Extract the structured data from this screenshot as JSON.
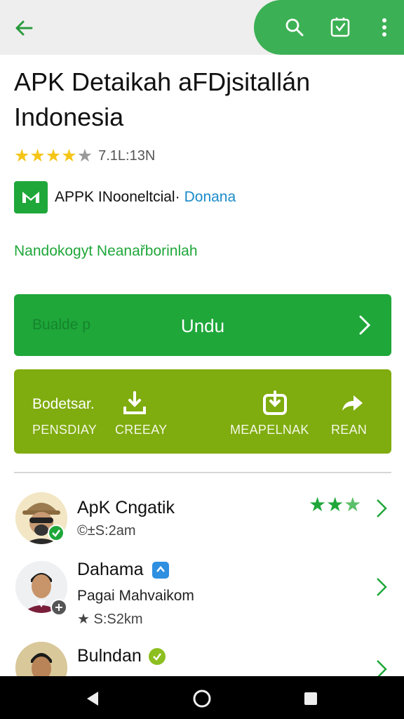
{
  "app_bar": {
    "back_icon": "arrow-left-icon",
    "search_icon": "search-icon",
    "badge_icon": "shield-badge-icon",
    "menu_icon": "more-vert-icon"
  },
  "app": {
    "title": "APK Detaikah aFDjsitallán Indonesia",
    "rating_stars": 4,
    "rating_text": "7.1L:13N",
    "developer_name": "APPK INooneltсial·",
    "developer_link": "Donana",
    "category": "Nandokogyt Neanařborinlah"
  },
  "install": {
    "faint_text": "Bualde p",
    "label": "Undu"
  },
  "actions": {
    "intro": "Bodetsar.",
    "items": [
      {
        "label": "PENSDIAY",
        "icon": ""
      },
      {
        "label": "CREEAY",
        "icon": "download-icon"
      },
      {
        "label": "MEAPELNAK",
        "icon": "download-icon"
      },
      {
        "label": "REAN",
        "icon": "share-arrow-icon"
      }
    ]
  },
  "list": [
    {
      "name": "ApK Cngatik",
      "sub": "©±S:2am",
      "stars": 3,
      "badge_color": "#1fa73a"
    },
    {
      "name": "Dahama",
      "line2": "Pagai Mahvaikom",
      "sub": "★ S:S2km",
      "badge_color": "#555555",
      "name_badge_color": "#2f8fe0"
    },
    {
      "name": "Bulndan",
      "name_badge_color": "#8cbf1f"
    }
  ],
  "colors": {
    "accent_green": "#1fa73a",
    "pill_green": "#3cb054",
    "panel_olive": "#7fac0e",
    "link_blue": "#1a8bc9",
    "star_gold": "#f5c518"
  }
}
